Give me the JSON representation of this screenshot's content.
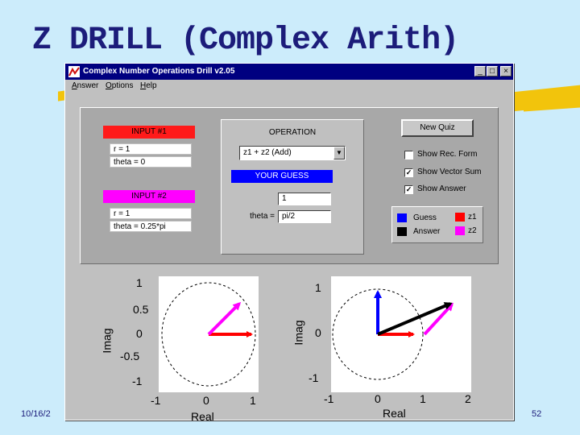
{
  "slide": {
    "title": "Z DRILL (Complex Arith)",
    "date": "10/16/2",
    "page_number": "52",
    "colors": {
      "background": "#ccecfb",
      "title": "#1c1c7a",
      "highlighter": "#f2c40c"
    }
  },
  "window": {
    "title": "Complex Number Operations Drill v2.05",
    "icon": "matlab-figure-icon",
    "controls": {
      "minimize": "_",
      "maximize": "□",
      "close": "×"
    },
    "menu": [
      "Answer",
      "Options",
      "Help"
    ]
  },
  "input1": {
    "header": "INPUT #1",
    "r": "r = 1",
    "theta": "theta = 0"
  },
  "input2": {
    "header": "INPUT #2",
    "r": "r = 1",
    "theta": "theta = 0.25*pi"
  },
  "operation": {
    "header": "OPERATION",
    "selected": "z1 + z2  (Add)"
  },
  "guess": {
    "header": "YOUR GUESS",
    "r_label": "r =",
    "r_value": "1",
    "theta_label": "theta =",
    "theta_value": "pi/2"
  },
  "buttons": {
    "new_quiz": "New Quiz"
  },
  "checkboxes": [
    {
      "label": "Show Rec. Form",
      "checked": false
    },
    {
      "label": "Show Vector Sum",
      "checked": true
    },
    {
      "label": "Show Answer",
      "checked": true
    }
  ],
  "legend": {
    "items": [
      {
        "label": "Guess",
        "color": "#0000ff"
      },
      {
        "label": "Answer",
        "color": "#000000"
      },
      {
        "label": "z1",
        "color": "#ff0000"
      },
      {
        "label": "z2",
        "color": "#ff00ff"
      }
    ]
  },
  "plots": {
    "left": {
      "xlabel": "Real",
      "ylabel": "Imag",
      "xticks": [
        "-1",
        "0",
        "1"
      ],
      "yticks": [
        "1",
        "0.5",
        "0",
        "-0.5",
        "-1"
      ]
    },
    "right": {
      "xlabel": "Real",
      "ylabel": "Imag",
      "xticks": [
        "-1",
        "0",
        "1",
        "2"
      ],
      "yticks": [
        "1",
        "0",
        "-1"
      ]
    }
  }
}
